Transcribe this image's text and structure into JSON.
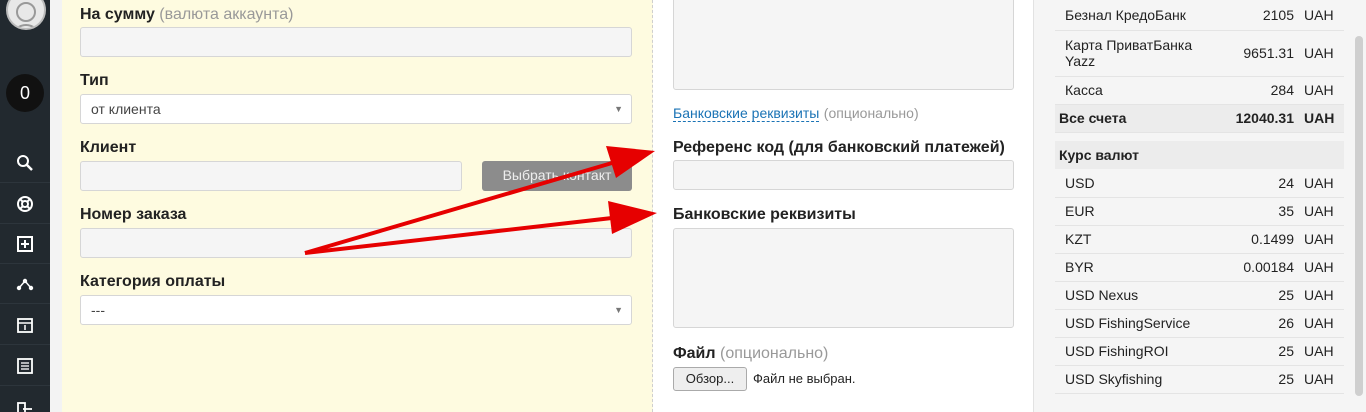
{
  "sidebar": {
    "badge": "0"
  },
  "form_left": {
    "amount_label": "На сумму",
    "amount_hint": "(валюта аккаунта)",
    "amount_value": "",
    "type_label": "Тип",
    "type_value": "от клиента",
    "client_label": "Клиент",
    "client_value": "",
    "choose_contact": "Выбрать контакт",
    "order_label": "Номер заказа",
    "order_value": "",
    "category_label": "Категория оплаты",
    "category_value": "---"
  },
  "form_mid": {
    "bank_details_link": "Банковские реквизиты",
    "optional": "(опционально)",
    "ref_code_label": "Референс код (для банковский платежей)",
    "bank_details_label": "Банковские реквизиты",
    "file_label": "Файл",
    "file_button": "Обзор...",
    "file_status": "Файл не выбран."
  },
  "accounts": {
    "rows": [
      {
        "name": "Безнал КредоБанк",
        "amount": "2105",
        "currency": "UAH"
      },
      {
        "name": "Карта ПриватБанка Yazz",
        "amount": "9651.31",
        "currency": "UAH"
      },
      {
        "name": "Касса",
        "amount": "284",
        "currency": "UAH"
      }
    ],
    "total": {
      "name": "Все счета",
      "amount": "12040.31",
      "currency": "UAH"
    }
  },
  "rates": {
    "title": "Курс валют",
    "rows": [
      {
        "name": "USD",
        "rate": "24",
        "currency": "UAH"
      },
      {
        "name": "EUR",
        "rate": "35",
        "currency": "UAH"
      },
      {
        "name": "KZT",
        "rate": "0.1499",
        "currency": "UAH"
      },
      {
        "name": "BYR",
        "rate": "0.00184",
        "currency": "UAH"
      },
      {
        "name": "USD Nexus",
        "rate": "25",
        "currency": "UAH"
      },
      {
        "name": "USD FishingService",
        "rate": "26",
        "currency": "UAH"
      },
      {
        "name": "USD FishingROI",
        "rate": "25",
        "currency": "UAH"
      },
      {
        "name": "USD Skyfishing",
        "rate": "25",
        "currency": "UAH"
      }
    ]
  },
  "colors": {
    "sidebar": "#22292f",
    "form_bg": "#fefbe0",
    "arrow": "#e60000",
    "link": "#1a73b5"
  }
}
